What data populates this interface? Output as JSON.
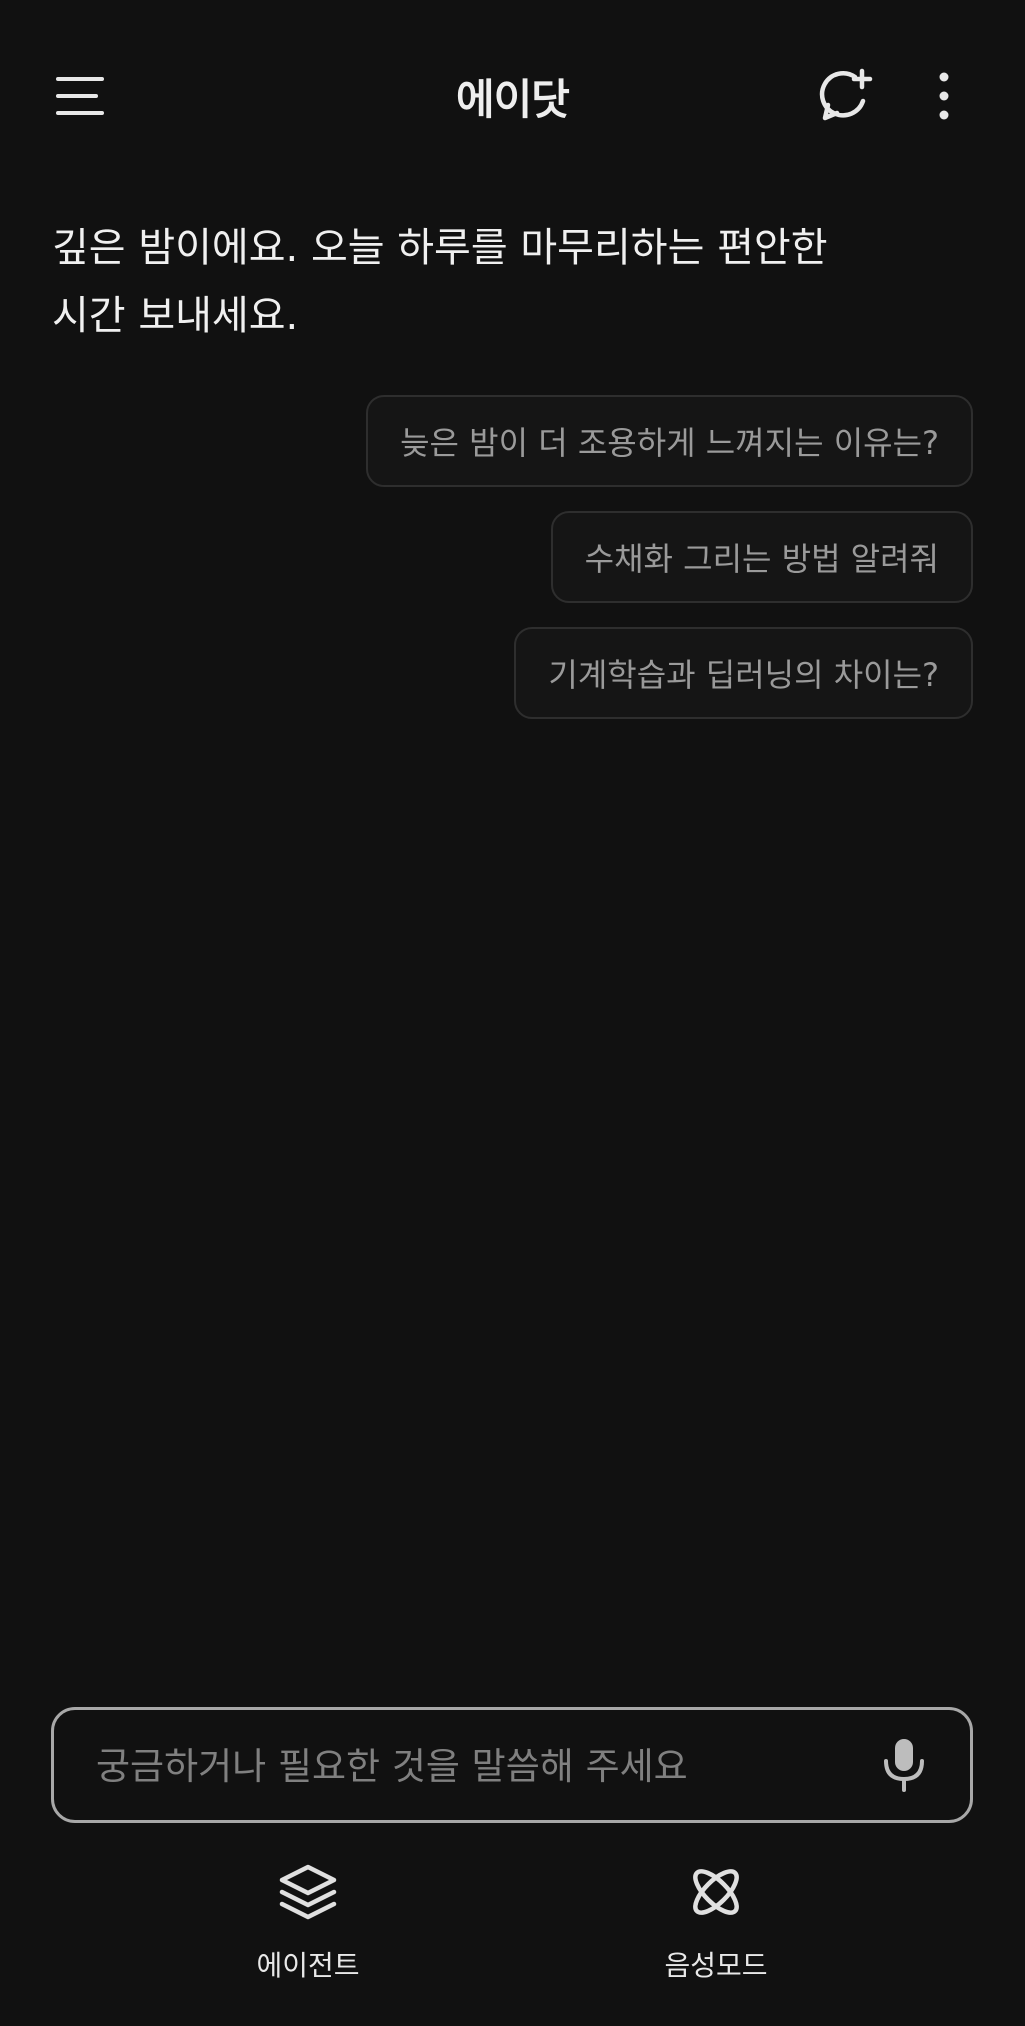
{
  "header": {
    "title": "에이닷",
    "menu_icon": "menu-icon",
    "new_chat_icon": "new-chat-icon",
    "more_icon": "more-vertical-icon"
  },
  "greeting": {
    "line1": "깊은 밤이에요. 오늘 하루를 마무리하는 편안한",
    "line2": "시간 보내세요."
  },
  "suggestions": [
    {
      "label": "늦은 밤이 더 조용하게 느껴지는 이유는?"
    },
    {
      "label": "수채화 그리는 방법 알려줘"
    },
    {
      "label": "기계학습과 딥러닝의 차이는?"
    }
  ],
  "input": {
    "value": "",
    "placeholder": "궁금하거나 필요한 것을 말씀해 주세요",
    "mic_icon": "microphone-icon"
  },
  "bottom_actions": [
    {
      "label": "에이전트",
      "icon": "layers-icon"
    },
    {
      "label": "음성모드",
      "icon": "orbit-icon"
    }
  ],
  "colors": {
    "background": "#111111",
    "text": "#f0f0f0",
    "chip_text": "#9a9a9a",
    "chip_border": "#2e2e2e",
    "input_border": "#a8a8a8",
    "placeholder": "#808080"
  }
}
